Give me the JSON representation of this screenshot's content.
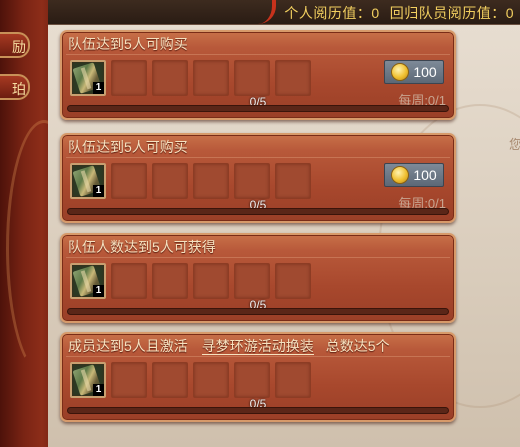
{
  "header": {
    "personal_label": "个人阅历值：0",
    "return_label": "回归队员阅历值：0"
  },
  "side_tabs": [
    {
      "label": "励"
    },
    {
      "label": "珀"
    }
  ],
  "edge_text": "您",
  "cards": [
    {
      "title": "队伍达到5人可购买",
      "item_count": "1",
      "price": "100",
      "weekly": "每周:0/1",
      "progress_text": "0/5",
      "progress": 0
    },
    {
      "title": "队伍达到5人可购买",
      "item_count": "1",
      "price": "100",
      "weekly": "每周:0/1",
      "progress_text": "0/5",
      "progress": 0
    },
    {
      "title": "队伍人数达到5人可获得",
      "item_count": "1",
      "progress_text": "0/5",
      "progress": 0
    },
    {
      "title": "成员达到5人且激活",
      "link": "寻梦环游活动换装",
      "extra": "总数达5个",
      "item_count": "1",
      "progress_text": "0/5",
      "progress": 0
    }
  ]
}
